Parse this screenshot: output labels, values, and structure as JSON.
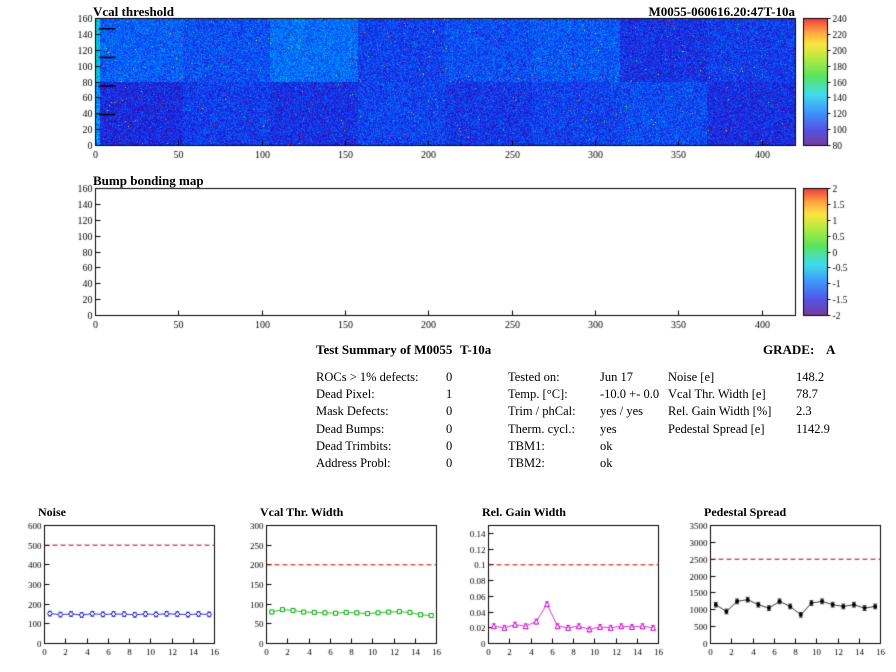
{
  "summary": {
    "title": "Test Summary of M0055",
    "temp": "T-10a",
    "grade_label": "GRADE:",
    "grade": "A",
    "defects": [
      {
        "label": "ROCs > 1% defects:",
        "value": "0"
      },
      {
        "label": "Dead Pixel:",
        "value": "1"
      },
      {
        "label": "Mask Defects:",
        "value": "0"
      },
      {
        "label": "Dead Bumps:",
        "value": "0"
      },
      {
        "label": "Dead Trimbits:",
        "value": "0"
      },
      {
        "label": "Address Probl:",
        "value": "0"
      }
    ],
    "conditions": [
      {
        "label": "Tested on:",
        "value": "Jun 17"
      },
      {
        "label": "Temp. [°C]:",
        "value": "-10.0 +- 0.0"
      },
      {
        "label": "Trim / phCal:",
        "value": "yes / yes"
      },
      {
        "label": "Therm. cycl.:",
        "value": "yes"
      },
      {
        "label": "TBM1:",
        "value": "ok"
      },
      {
        "label": "TBM2:",
        "value": "ok"
      }
    ],
    "results": [
      {
        "label": "Noise [e]",
        "value": "148.2"
      },
      {
        "label": "Vcal Thr. Width [e]",
        "value": "78.7"
      },
      {
        "label": "Rel. Gain Width [%]",
        "value": "2.3"
      },
      {
        "label": "Pedestal Spread [e]",
        "value": "1142.9"
      }
    ]
  },
  "chart_data": [
    {
      "type": "heatmap",
      "title": "Vcal threshold",
      "right_label": "M0055-060616.20:47T-10a",
      "xlim": [
        0,
        420
      ],
      "ylim": [
        0,
        160
      ],
      "x_ticks": [
        0,
        50,
        100,
        150,
        200,
        250,
        300,
        350,
        400
      ],
      "y_ticks": [
        0,
        20,
        40,
        60,
        80,
        100,
        120,
        140,
        160
      ],
      "colorbar": {
        "min": 80,
        "max": 240,
        "ticks": [
          80,
          100,
          120,
          140,
          160,
          180,
          200,
          220,
          240
        ]
      },
      "row_top": [
        116,
        112,
        120,
        108,
        112,
        114,
        104,
        107
      ],
      "row_bottom": [
        102,
        107,
        104,
        109,
        105,
        108,
        111,
        103
      ],
      "noise_sigma": 8,
      "speckle_prob": 0.004,
      "seed": 42,
      "dead_marks": [
        [
          2,
          147
        ],
        [
          2,
          111
        ],
        [
          2,
          75
        ],
        [
          2,
          39
        ]
      ]
    },
    {
      "type": "heatmap_empty",
      "title": "Bump bonding map",
      "xlim": [
        0,
        420
      ],
      "ylim": [
        0,
        160
      ],
      "x_ticks": [
        0,
        50,
        100,
        150,
        200,
        250,
        300,
        350,
        400
      ],
      "y_ticks": [
        0,
        20,
        40,
        60,
        80,
        100,
        120,
        140,
        160
      ],
      "colorbar": {
        "min": -2,
        "max": 2,
        "ticks": [
          -2,
          -1.5,
          -1,
          -0.5,
          0,
          0.5,
          1,
          1.5,
          2
        ]
      }
    },
    {
      "type": "line",
      "title": "Noise",
      "color": "#0000bb",
      "ref_color": "#bb0000",
      "marker": "diamond",
      "xlim": [
        0,
        16
      ],
      "x_ticks": [
        0,
        2,
        4,
        6,
        8,
        10,
        12,
        14,
        16
      ],
      "ylim": [
        0,
        600
      ],
      "y_ticks": [
        0,
        100,
        200,
        300,
        400,
        500,
        600
      ],
      "ref_line": 500,
      "yerr": 12,
      "x": [
        0.5,
        1.5,
        2.5,
        3.5,
        4.5,
        5.5,
        6.5,
        7.5,
        8.5,
        9.5,
        10.5,
        11.5,
        12.5,
        13.5,
        14.5,
        15.5
      ],
      "values": [
        152,
        147,
        150,
        145,
        151,
        148,
        150,
        149,
        146,
        150,
        148,
        151,
        149,
        147,
        150,
        148
      ]
    },
    {
      "type": "line",
      "title": "Vcal Thr. Width",
      "color": "#00aa00",
      "ref_color": "#bb0000",
      "marker": "square",
      "xlim": [
        0,
        16
      ],
      "x_ticks": [
        0,
        2,
        4,
        6,
        8,
        10,
        12,
        14,
        16
      ],
      "ylim": [
        0,
        300
      ],
      "y_ticks": [
        0,
        50,
        100,
        150,
        200,
        250,
        300
      ],
      "ref_line": 200,
      "yerr": 4,
      "x": [
        0.5,
        1.5,
        2.5,
        3.5,
        4.5,
        5.5,
        6.5,
        7.5,
        8.5,
        9.5,
        10.5,
        11.5,
        12.5,
        13.5,
        14.5,
        15.5
      ],
      "values": [
        80,
        86,
        84,
        80,
        79,
        78,
        77,
        79,
        78,
        76,
        78,
        80,
        81,
        79,
        73,
        71
      ]
    },
    {
      "type": "line",
      "title": "Rel. Gain Width",
      "color": "#cc00cc",
      "ref_color": "#bb0000",
      "marker": "triangle",
      "xlim": [
        0,
        16
      ],
      "x_ticks": [
        0,
        2,
        4,
        6,
        8,
        10,
        12,
        14,
        16
      ],
      "ylim": [
        0,
        0.15
      ],
      "y_ticks": [
        0,
        0.02,
        0.04,
        0.06,
        0.08,
        0.1,
        0.12,
        0.14
      ],
      "ref_line": 0.1,
      "yerr": 0.003,
      "x": [
        0.5,
        1.5,
        2.5,
        3.5,
        4.5,
        5.5,
        6.5,
        7.5,
        8.5,
        9.5,
        10.5,
        11.5,
        12.5,
        13.5,
        14.5,
        15.5
      ],
      "values": [
        0.022,
        0.02,
        0.024,
        0.022,
        0.028,
        0.05,
        0.022,
        0.02,
        0.022,
        0.018,
        0.021,
        0.02,
        0.022,
        0.021,
        0.022,
        0.02
      ]
    },
    {
      "type": "line",
      "title": "Pedestal Spread",
      "color": "#000000",
      "ref_color": "#bb0000",
      "marker": "dot",
      "xlim": [
        0,
        16
      ],
      "x_ticks": [
        0,
        2,
        4,
        6,
        8,
        10,
        12,
        14,
        16
      ],
      "ylim": [
        0,
        3500
      ],
      "y_ticks": [
        0,
        500,
        1000,
        1500,
        2000,
        2500,
        3000,
        3500
      ],
      "ref_line": 2500,
      "yerr": 70,
      "x": [
        0.5,
        1.5,
        2.5,
        3.5,
        4.5,
        5.5,
        6.5,
        7.5,
        8.5,
        9.5,
        10.5,
        11.5,
        12.5,
        13.5,
        14.5,
        15.5
      ],
      "values": [
        1150,
        950,
        1250,
        1300,
        1150,
        1050,
        1250,
        1100,
        850,
        1200,
        1250,
        1150,
        1100,
        1150,
        1050,
        1100
      ]
    }
  ]
}
